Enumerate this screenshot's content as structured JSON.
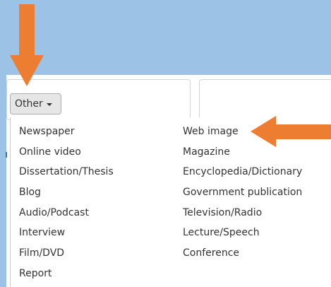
{
  "dropdown": {
    "selected_label": "Other",
    "icon": "caret-down-icon"
  },
  "menu": {
    "column_1": [
      "Newspaper",
      "Online video",
      "Dissertation/Thesis",
      "Blog",
      "Audio/Podcast",
      "Interview",
      "Film/DVD",
      "Report"
    ],
    "column_2": [
      "Web image",
      "Magazine",
      "Encyclopedia/Dictionary",
      "Government publication",
      "Television/Radio",
      "Lecture/Speech",
      "Conference"
    ]
  },
  "annotations": {
    "arrow_color": "#ed7d31",
    "background_color": "#9cc2e5"
  }
}
